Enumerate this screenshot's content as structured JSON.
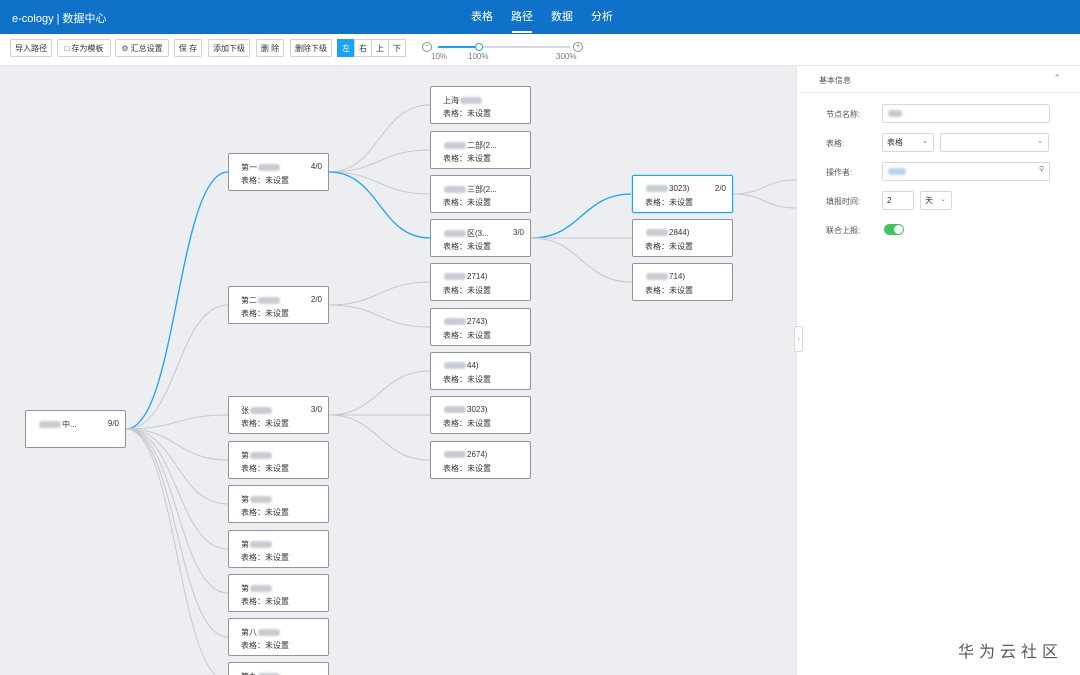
{
  "app": {
    "title": "e-cology | 数据中心"
  },
  "nav": {
    "tabs": [
      "表格",
      "路径",
      "数据",
      "分析"
    ],
    "active": 1
  },
  "toolbar": {
    "import_path": "导入路径",
    "save_template": "存为模板",
    "summary_settings": "汇总设置",
    "save": "保 存",
    "add_child": "添加下级",
    "delete": "删 除",
    "delete_child": "删除下级",
    "directions": [
      "左",
      "右",
      "上",
      "下"
    ],
    "active_direction": 0,
    "zoom": {
      "min_label": "10%",
      "current_label": "100%",
      "max_label": "300%",
      "min": 10,
      "value": 100,
      "max": 300
    }
  },
  "tree": {
    "nodes": [
      {
        "id": "root",
        "name": "中...",
        "count": "9/0",
        "sub": ""
      },
      {
        "id": "c1",
        "name": "第一",
        "count": "4/0",
        "sub": "表格：未设置"
      },
      {
        "id": "c2",
        "name": "第二",
        "count": "2/0",
        "sub": "表格：未设置"
      },
      {
        "id": "c3",
        "name": "张",
        "count": "3/0",
        "sub": "表格：未设置"
      },
      {
        "id": "c4",
        "name": "第",
        "count": "",
        "sub": "表格：未设置"
      },
      {
        "id": "c5",
        "name": "第",
        "count": "",
        "sub": "表格：未设置"
      },
      {
        "id": "c6",
        "name": "第",
        "count": "",
        "sub": "表格：未设置"
      },
      {
        "id": "c7",
        "name": "第",
        "count": "",
        "sub": "表格：未设置"
      },
      {
        "id": "c8",
        "name": "第八",
        "count": "",
        "sub": "表格：未设置"
      },
      {
        "id": "c9",
        "name": "第九",
        "count": "",
        "sub": ""
      },
      {
        "id": "g1",
        "name": "上海",
        "count": "",
        "sub": "表格：未设置"
      },
      {
        "id": "g2",
        "name": "二部(2...",
        "count": "",
        "sub": "表格：未设置"
      },
      {
        "id": "g3",
        "name": "三部(2...",
        "count": "",
        "sub": "表格：未设置"
      },
      {
        "id": "g4",
        "name": "区(3...",
        "count": "3/0",
        "sub": "表格：未设置"
      },
      {
        "id": "g5",
        "name": "2714)",
        "count": "",
        "sub": "表格：未设置"
      },
      {
        "id": "g6",
        "name": "2743)",
        "count": "",
        "sub": "表格：未设置"
      },
      {
        "id": "g7",
        "name": "44)",
        "count": "",
        "sub": "表格：未设置"
      },
      {
        "id": "g8",
        "name": "3023)",
        "count": "",
        "sub": "表格：未设置"
      },
      {
        "id": "g9",
        "name": "2674)",
        "count": "",
        "sub": "表格：未设置"
      },
      {
        "id": "h1",
        "name": "3023)",
        "count": "2/0",
        "sub": "表格：未设置"
      },
      {
        "id": "h2",
        "name": "2844)",
        "count": "",
        "sub": "表格：未设置"
      },
      {
        "id": "h3",
        "name": "714)",
        "count": "",
        "sub": "表格：未设置"
      }
    ]
  },
  "panel": {
    "title": "基本信息",
    "fields": {
      "node_name_label": "节点名称:",
      "form_label": "表格:",
      "form_type_value": "表格",
      "operator_label": "操作者:",
      "report_time_label": "填报时间:",
      "report_time_value": "2",
      "report_time_unit": "天",
      "joint_report_label": "联合上报:"
    },
    "joint_report_on": true
  },
  "colors": {
    "topbar": "#0f72c8",
    "accent": "#1aa3f5",
    "toggle": "#43c45a"
  },
  "icons": {
    "save_template": "template-icon",
    "summary": "gear-icon",
    "collapse": "chevron-up-icon",
    "search": "search-icon"
  },
  "watermark": "华为云社区"
}
